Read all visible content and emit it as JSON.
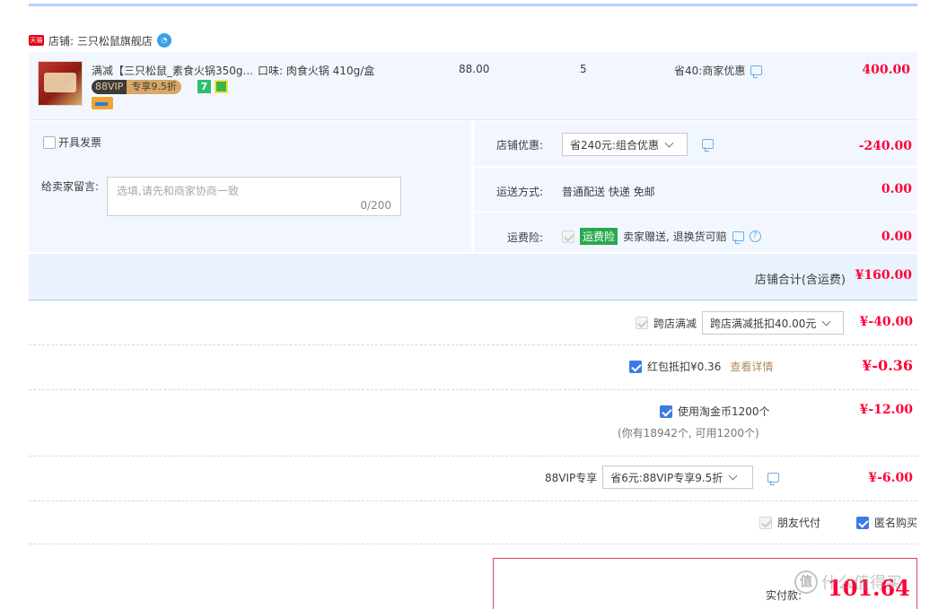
{
  "shop": {
    "badge": "天猫",
    "name": "店铺: 三只松鼠旗舰店",
    "chat_icon": "wangwang-chat-icon"
  },
  "item": {
    "title": "满减【三只松鼠_素食火锅350g...",
    "flavor": "口味: 肉食火锅 410g/盒",
    "vip_left": "88VIP",
    "vip_right": "专享9.5折",
    "seven_label": "7",
    "price": "88.00",
    "quantity": "5",
    "promo": "省40:商家优惠",
    "subtotal": "400.00"
  },
  "invoice": {
    "label": "开具发票"
  },
  "message": {
    "label": "给卖家留言:",
    "placeholder": "选填,请先和商家协商一致",
    "count": "0/200"
  },
  "store_discount": {
    "label": "店铺优惠:",
    "selected": "省240元:组合优惠",
    "amount": "-240.00"
  },
  "shipping": {
    "label": "运送方式:",
    "value": "普通配送 快递 免邮",
    "amount": "0.00"
  },
  "insurance": {
    "label": "运费险:",
    "tag": "运费险",
    "value": "卖家赠送, 退换货可赔",
    "amount": "0.00"
  },
  "store_total": {
    "label": "店铺合计(含运费)",
    "amount": "¥160.00"
  },
  "cross_store": {
    "label": "跨店满减",
    "selected": "跨店满减抵扣40.00元",
    "amount": "¥-40.00"
  },
  "red_packet": {
    "label": "红包抵扣¥0.36",
    "detail_link": "查看详情",
    "amount": "¥-0.36"
  },
  "coins": {
    "label": "使用淘金币1200个",
    "note": "(你有18942个, 可用1200个)",
    "amount": "¥-12.00"
  },
  "vip_discount": {
    "label": "88VIP专享",
    "selected": "省6元:88VIP专享9.5折",
    "amount": "¥-6.00"
  },
  "options": {
    "friend_pay": "朋友代付",
    "anonymous": "匿名购买"
  },
  "payment": {
    "label": "实付款:",
    "amount": "101.64"
  },
  "watermark": {
    "logo": "值",
    "text": "什么值得买"
  },
  "colors": {
    "accent_red": "#ff0036",
    "panel_bg": "#f2f7ff",
    "checkbox_blue": "#3b7ce6",
    "insurance_green": "#2aa84f"
  }
}
